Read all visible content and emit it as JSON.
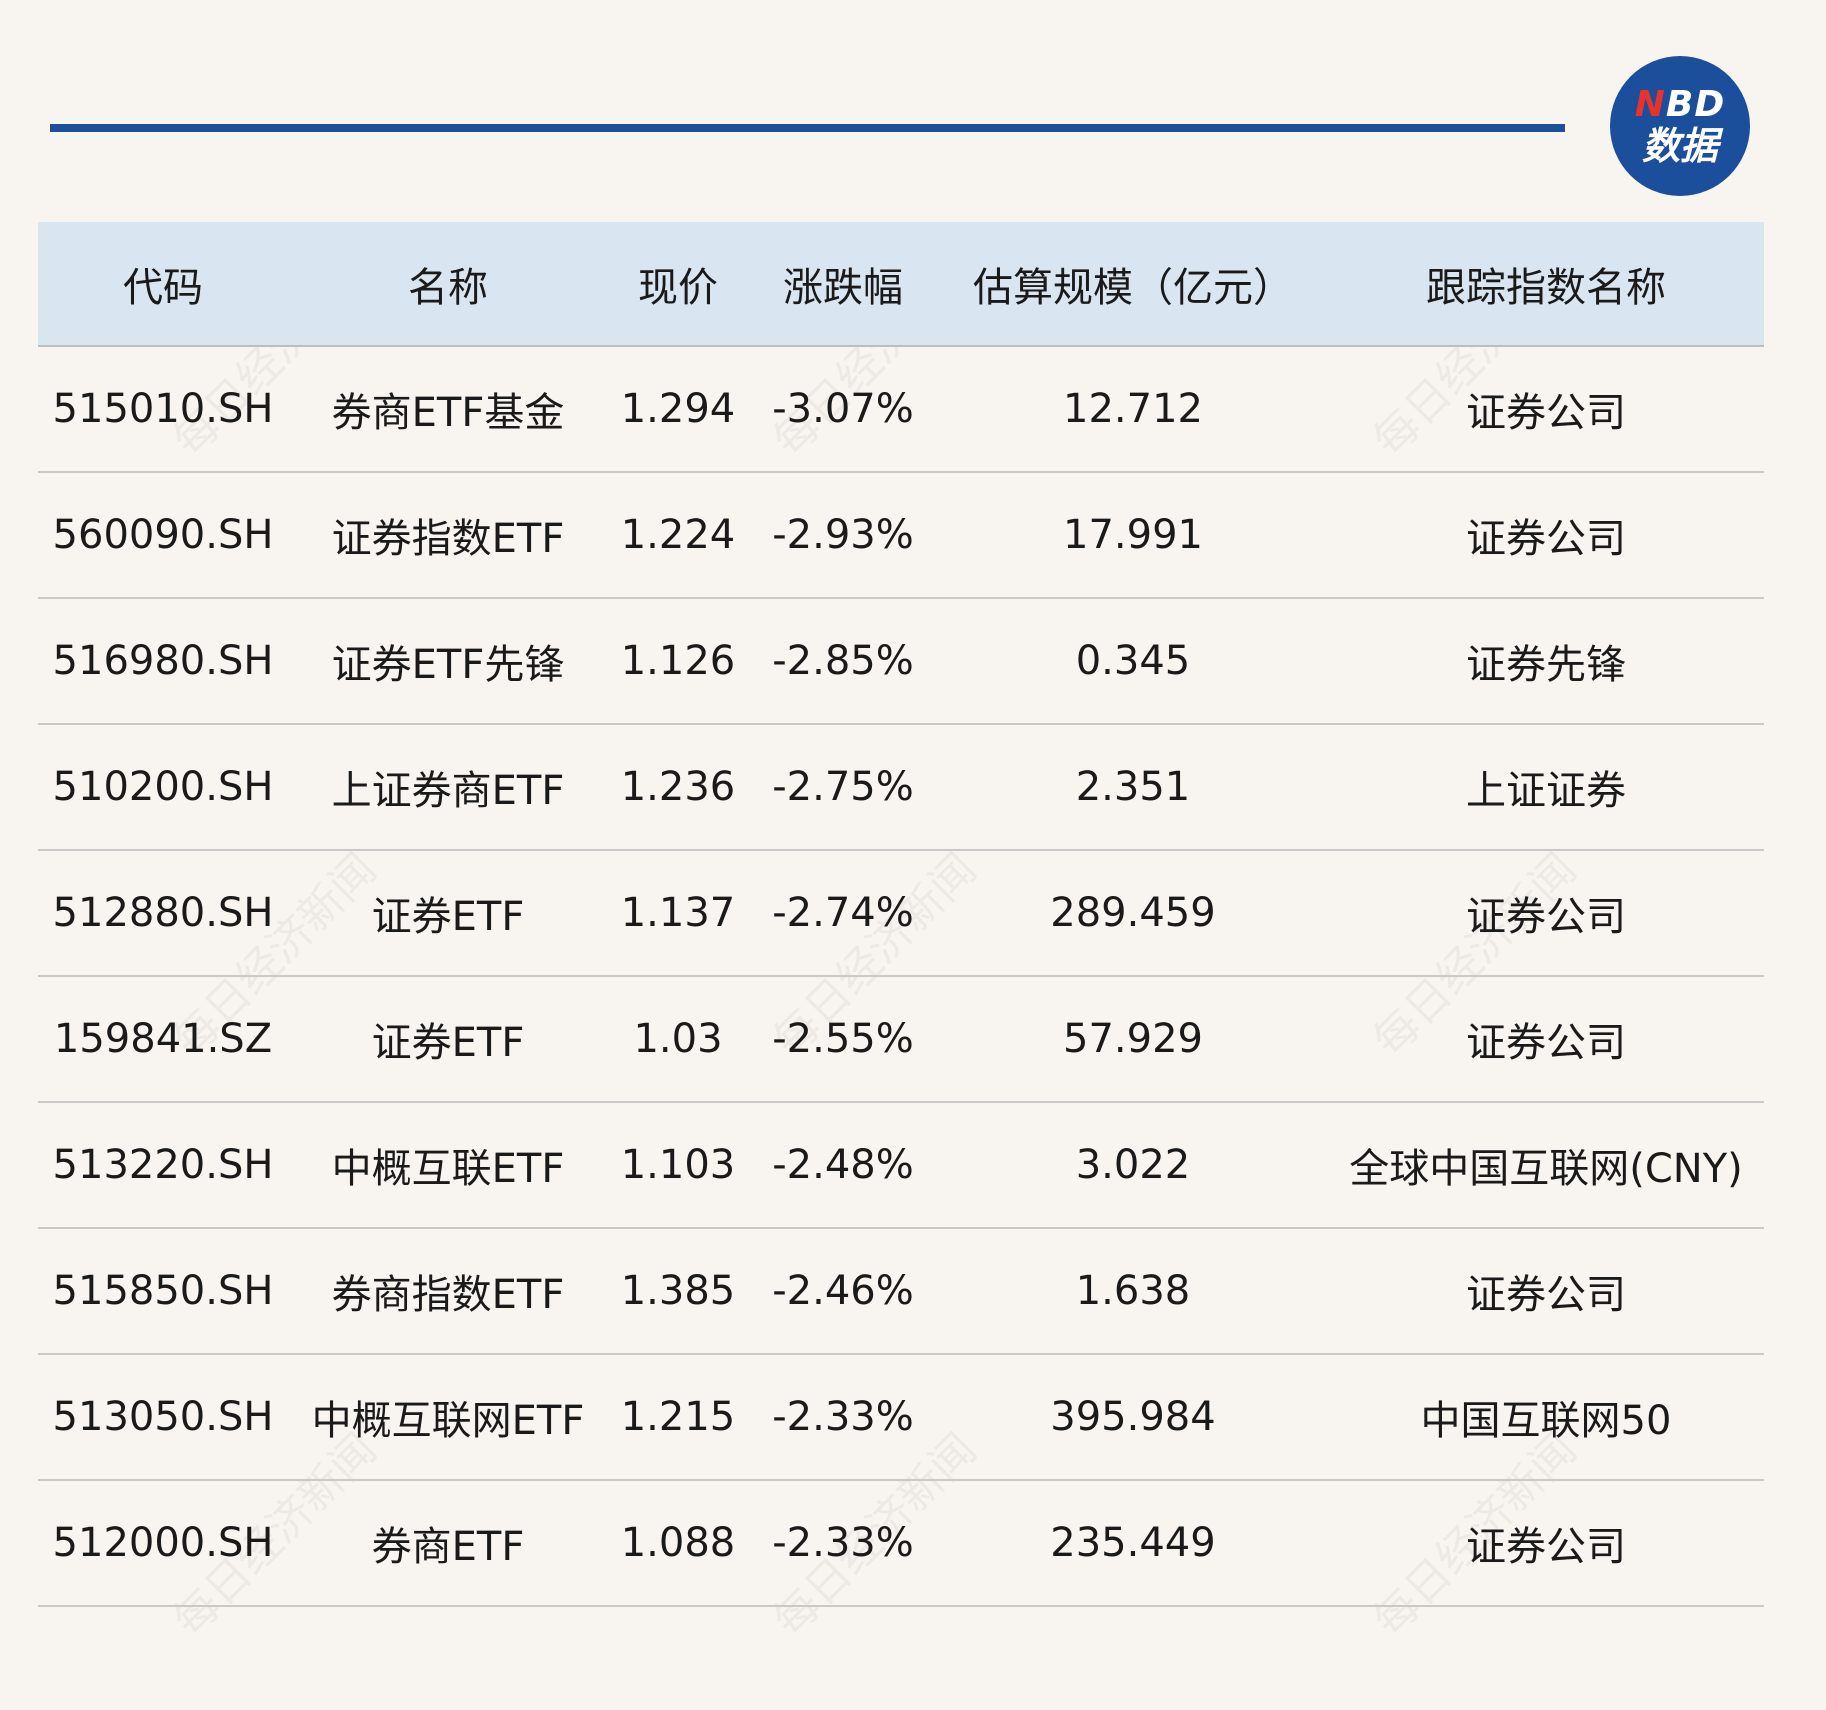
{
  "logo": {
    "n": "N",
    "bd": "BD",
    "sub": "数据"
  },
  "watermark": "每日经济新闻",
  "table": {
    "headers": [
      "代码",
      "名称",
      "现价",
      "涨跌幅",
      "估算规模（亿元）",
      "跟踪指数名称"
    ],
    "rows": [
      [
        "515010.SH",
        "券商ETF基金",
        "1.294",
        "-3.07%",
        "12.712",
        "证券公司"
      ],
      [
        "560090.SH",
        "证券指数ETF",
        "1.224",
        "-2.93%",
        "17.991",
        "证券公司"
      ],
      [
        "516980.SH",
        "证券ETF先锋",
        "1.126",
        "-2.85%",
        "0.345",
        "证券先锋"
      ],
      [
        "510200.SH",
        "上证券商ETF",
        "1.236",
        "-2.75%",
        "2.351",
        "上证证券"
      ],
      [
        "512880.SH",
        "证券ETF",
        "1.137",
        "-2.74%",
        "289.459",
        "证券公司"
      ],
      [
        "159841.SZ",
        "证券ETF",
        "1.03",
        "-2.55%",
        "57.929",
        "证券公司"
      ],
      [
        "513220.SH",
        "中概互联ETF",
        "1.103",
        "-2.48%",
        "3.022",
        "全球中国互联网(CNY)"
      ],
      [
        "515850.SH",
        "券商指数ETF",
        "1.385",
        "-2.46%",
        "1.638",
        "证券公司"
      ],
      [
        "513050.SH",
        "中概互联网ETF",
        "1.215",
        "-2.33%",
        "395.984",
        "中国互联网50"
      ],
      [
        "512000.SH",
        "券商ETF",
        "1.088",
        "-2.33%",
        "235.449",
        "证券公司"
      ]
    ]
  }
}
